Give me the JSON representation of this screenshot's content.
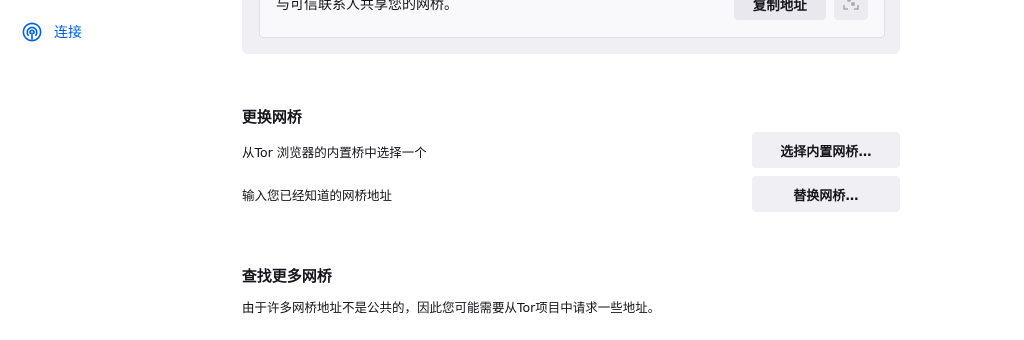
{
  "sidebar": {
    "items": [
      {
        "label": "连接",
        "icon": "connection-icon",
        "color": "#0061e0"
      }
    ]
  },
  "share_card": {
    "text": "与可信联系人共享您的网桥。",
    "copy_button": "复制地址",
    "qr_icon": "qr-code-icon"
  },
  "change_bridge": {
    "heading": "更换网桥",
    "rows": [
      {
        "text": "从Tor 浏览器的内置桥中选择一个",
        "button": "选择内置网桥…"
      },
      {
        "text": "输入您已经知道的网桥地址",
        "button": "替换网桥…"
      }
    ]
  },
  "find_more": {
    "heading": "查找更多网桥",
    "text": "由于许多网桥地址不是公共的，因此您可能需要从Tor项目中请求一些地址。"
  },
  "colors": {
    "accent": "#0061e0",
    "button_bg": "#f0f0f4",
    "text": "#15141a"
  }
}
